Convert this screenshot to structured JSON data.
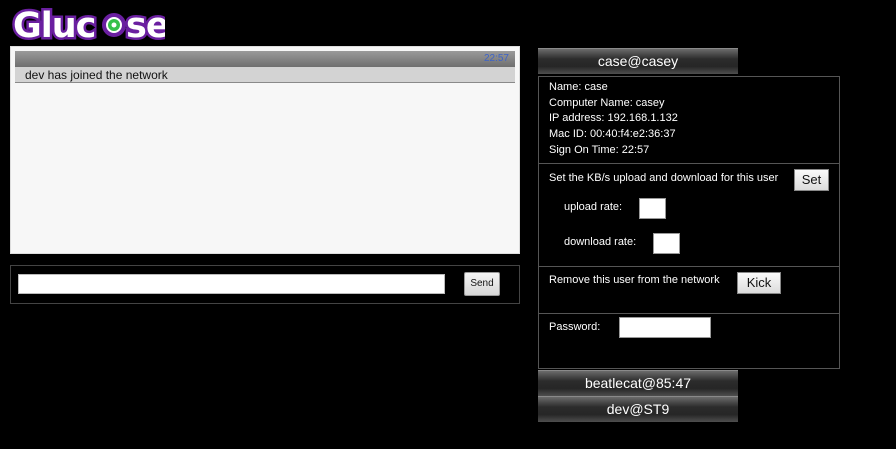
{
  "app": {
    "logo_text": "Glucose"
  },
  "chat": {
    "timestamp": "22:57",
    "messages": [
      "dev has joined the network"
    ]
  },
  "entry": {
    "value": "",
    "send_label": "Send"
  },
  "users": [
    {
      "label": "case@casey"
    },
    {
      "label": "beatlecat@85:47"
    },
    {
      "label": "dev@ST9"
    }
  ],
  "details": {
    "name": "Name: case",
    "computer_name": "Computer Name: casey",
    "ip": "IP address: 192.168.1.132",
    "mac": "Mac ID: 00:40:f4:e2:36:37",
    "sign_on": "Sign On Time: 22:57"
  },
  "rate": {
    "heading": "Set the KB/s upload and download for this user",
    "set_label": "Set",
    "upload_label": "upload rate:",
    "download_label": "download rate:",
    "upload_value": "",
    "download_value": ""
  },
  "kick": {
    "text": "Remove this user from the network",
    "button_label": "Kick"
  },
  "password": {
    "label": "Password:",
    "value": ""
  },
  "colors": {
    "logo_purple": "#6a1fa0",
    "timestamp_blue": "#3d63c8",
    "logo_green": "#35c04a"
  }
}
